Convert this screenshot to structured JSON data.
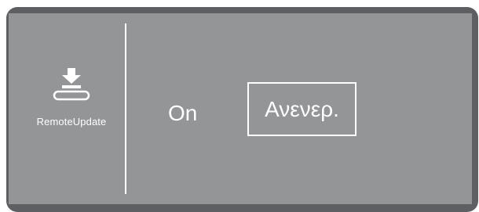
{
  "side_panel": {
    "icon": "download-icon",
    "label": "RemoteUpdate"
  },
  "options": {
    "on_label": "On",
    "off_label": "Ανενερ.",
    "selected": "Ανενερ."
  },
  "colors": {
    "bezel": "#5d5f62",
    "screen": "#939597",
    "foreground": "#ffffff"
  }
}
